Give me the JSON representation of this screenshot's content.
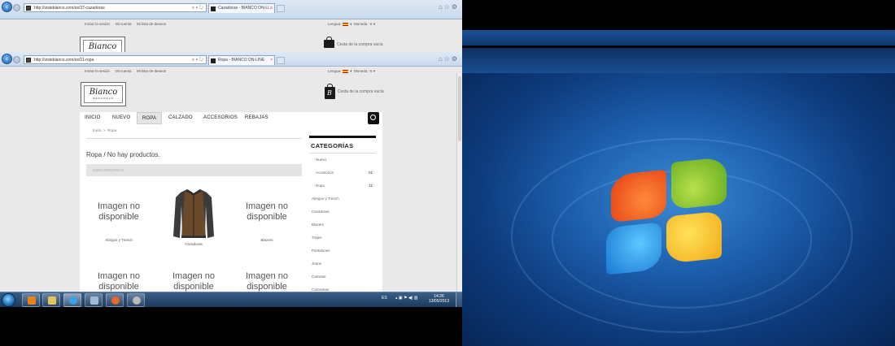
{
  "window1": {
    "address": "http://vistebianco.com/es/37-cazadoras",
    "tab_title": "Cazadoras - BIANCO ON-LI...",
    "page": {
      "links": [
        "Iniciar la sesión",
        "Mi cuenta",
        "Mi lista de deseos"
      ],
      "lengua_label": "Lengua:",
      "moneda_label": "Moneda : €",
      "cart_label": "Cesta de la compra vacía"
    }
  },
  "window2": {
    "address": "http://vistebianco.com/es/11-ropa",
    "tab_title": "Ropa - BIANCO ON-LINE",
    "topbar": {
      "links": [
        "Iniciar la sesión",
        "Mi cuenta",
        "Mi lista de deseos"
      ],
      "lengua_label": "Lengua:",
      "moneda_label": "Moneda : €"
    },
    "logo": {
      "brand": "Bianco",
      "sub": "MENSWEAR"
    },
    "cart_label": "Cesta de la compra vacía",
    "menu": [
      "INICIO",
      "NUEVO",
      "ROPA",
      "CALZADO",
      "ACCESORIOS",
      "REBAJAS"
    ],
    "breadcrumb": {
      "home": "Inicio",
      "sep": ">",
      "current": "Ropa"
    },
    "page_title": "Ropa  / No hay productos.",
    "sort_label": "SUBCATEGORÍAS",
    "products": [
      {
        "placeholder": "Imagen no disponible",
        "name": "Abrigos y Trench"
      },
      {
        "placeholder": "",
        "name": "Cazadoras"
      },
      {
        "placeholder": "Imagen no disponible",
        "name": "Blazers"
      },
      {
        "placeholder": "Imagen no disponible",
        "name": ""
      },
      {
        "placeholder": "Imagen no disponible",
        "name": ""
      },
      {
        "placeholder": "Imagen no disponible",
        "name": ""
      }
    ],
    "sidebar": {
      "title": "CATEGORÍAS",
      "items": [
        {
          "label": "Nuevo",
          "count": ""
        },
        {
          "label": "Accesorios",
          "count": "01"
        },
        {
          "label": "Ropa",
          "count": "11"
        },
        {
          "label": "Abrigos y Trench",
          "count": ""
        },
        {
          "label": "Cazadoras",
          "count": ""
        },
        {
          "label": "Blazers",
          "count": ""
        },
        {
          "label": "Trajes",
          "count": ""
        },
        {
          "label": "Pantalones",
          "count": ""
        },
        {
          "label": "Jeans",
          "count": ""
        },
        {
          "label": "Camisas",
          "count": ""
        },
        {
          "label": "Camisetas",
          "count": ""
        }
      ]
    }
  },
  "taskbar": {
    "language": "ES",
    "time": "14:26",
    "date": "13/05/2013"
  },
  "colors": {
    "taskbar": "#1c3a5e",
    "ie_frame": "#c9d9ec",
    "desktop": "#1d5fae",
    "menu_active": "#e5e5e5",
    "jacket_body": "#6b4a2c",
    "jacket_sleeves": "#3b3b3b"
  }
}
